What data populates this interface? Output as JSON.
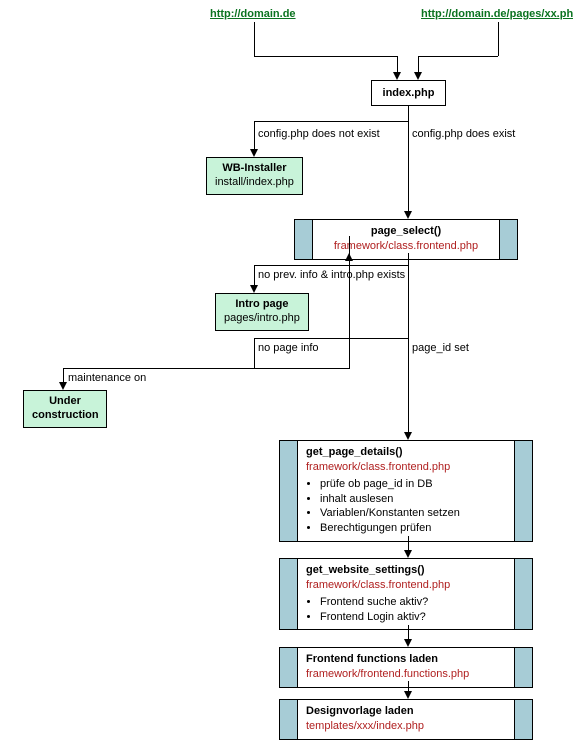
{
  "entry": {
    "urlLeft": "http://domain.de",
    "urlRight": "http://domain.de/pages/xx.php"
  },
  "index": {
    "label": "index.php"
  },
  "installer": {
    "title": "WB-Installer",
    "path": "install/index.php"
  },
  "pageSelect": {
    "title": "page_select()",
    "path": "framework/class.frontend.php"
  },
  "intro": {
    "title": "Intro page",
    "path": "pages/intro.php"
  },
  "under": {
    "title": "Under\nconstruction"
  },
  "getPageDetails": {
    "title": "get_page_details()",
    "path": "framework/class.frontend.php",
    "items": [
      "prüfe ob page_id in DB",
      "inhalt auslesen",
      "Variablen/Konstanten setzen",
      "Berechtigungen prüfen"
    ]
  },
  "getWebsiteSettings": {
    "title": "get_website_settings()",
    "path": "framework/class.frontend.php",
    "items": [
      "Frontend suche aktiv?",
      "Frontend Login aktiv?"
    ]
  },
  "frontendFns": {
    "title": "Frontend functions laden",
    "path": "framework/frontend.functions.php"
  },
  "design": {
    "title": "Designvorlage laden",
    "path": "templates/xxx/index.php"
  },
  "labels": {
    "configNotExist": "config.php does not exist",
    "configExist": "config.php does exist",
    "noPrevInfo": "no prev. info & intro.php exists",
    "noPageInfo": "no page info",
    "maintenance": "maintenance on",
    "pageIdSet": "page_id set"
  }
}
